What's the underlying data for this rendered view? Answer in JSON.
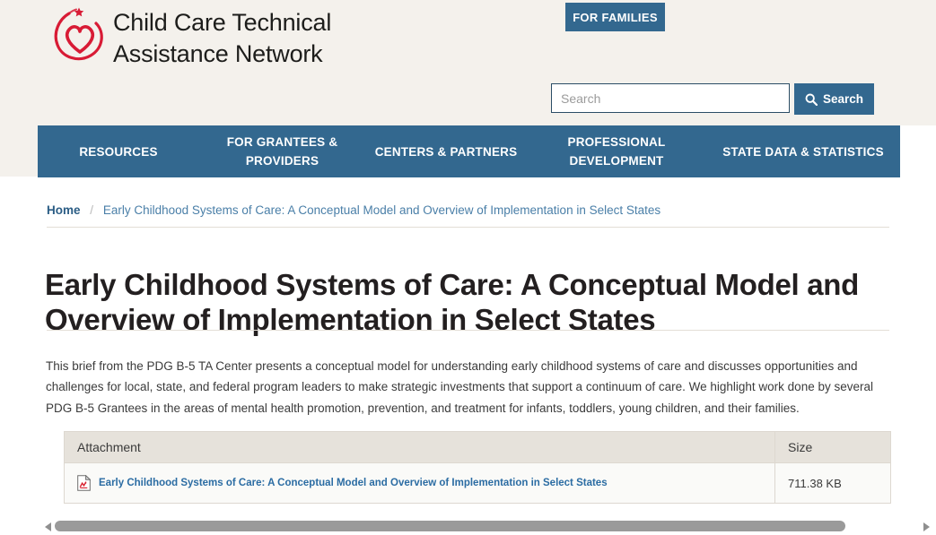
{
  "site": {
    "brand_line1": "Child Care Technical",
    "brand_line2": "Assistance Network",
    "logo_alt": "heart-circle-logo"
  },
  "header": {
    "for_families_label": "FOR FAMILIES",
    "accent_color": "#33688F",
    "band_color": "#F4F1EC"
  },
  "search": {
    "placeholder": "Search",
    "value": "",
    "button_label": "Search",
    "icon": "search-icon"
  },
  "nav": {
    "items": [
      {
        "label": "RESOURCES"
      },
      {
        "label": "FOR GRANTEES & PROVIDERS"
      },
      {
        "label": "CENTERS & PARTNERS"
      },
      {
        "label": "PROFESSIONAL DEVELOPMENT"
      },
      {
        "label": "STATE DATA & STATISTICS"
      }
    ]
  },
  "breadcrumb": {
    "home_label": "Home",
    "separator": "/",
    "current_label": "Early Childhood Systems of Care: A Conceptual Model and Overview of Implementation in Select States"
  },
  "main": {
    "title": "Early Childhood Systems of Care: A Conceptual Model and Overview of Implementation in Select States",
    "body": "This brief from the PDG B-5 TA Center presents a conceptual model for understanding early childhood systems of care and discusses opportunities and challenges for local, state, and federal program leaders to make strategic investments that support a continuum of care. We highlight work done by several PDG B-5 Grantees in the areas of mental health promotion, prevention, and treatment for infants, toddlers, young children, and their families."
  },
  "attachments": {
    "headers": [
      "Attachment",
      "Size"
    ],
    "rows": [
      {
        "icon": "pdf-file-icon",
        "name": "Early Childhood Systems of Care: A Conceptual Model and Overview of Implementation in Select States",
        "size": "711.38 KB"
      }
    ]
  },
  "scrollbar": {
    "left_arrow": "chevron-left-icon",
    "right_arrow": "chevron-right-icon",
    "thumb_ratio": "91.5%"
  }
}
